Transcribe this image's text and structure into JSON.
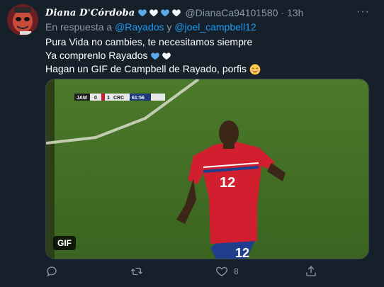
{
  "tweet": {
    "display_name": "Diana D'Córdoba",
    "name_hearts": [
      "blue",
      "white",
      "blue",
      "white"
    ],
    "handle": "@DianaCa94101580",
    "separator": "·",
    "time": "13h",
    "more_label": "···",
    "reply": {
      "prefix": "En respuesta a",
      "mention1": "@Rayados",
      "joiner": "y",
      "mention2": "@joel_campbell12"
    },
    "lines": [
      "Pura Vida no cambies, te necesitamos siempre",
      "Ya comprenlo Rayados",
      "Hagan un GIF de Campbell de Rayado, porfis"
    ],
    "line2_hearts": [
      "blue",
      "white"
    ],
    "line3_emoji": "smiling-face-blush",
    "media": {
      "badge": "GIF",
      "scoreboard": {
        "team1": "JAM",
        "score1": "0",
        "score2": "1",
        "team2": "CRC",
        "clock": "61:56"
      },
      "jersey_number": "12"
    },
    "actions": {
      "reply_count": "",
      "retweet_count": "",
      "like_count": "8"
    }
  },
  "colors": {
    "background": "#15202b",
    "secondary_text": "#8b98a5",
    "accent": "#1d9bf0",
    "heart_blue": "#5da9e9",
    "heart_white": "#f5f8fa",
    "jersey_red": "#d21f2f"
  }
}
